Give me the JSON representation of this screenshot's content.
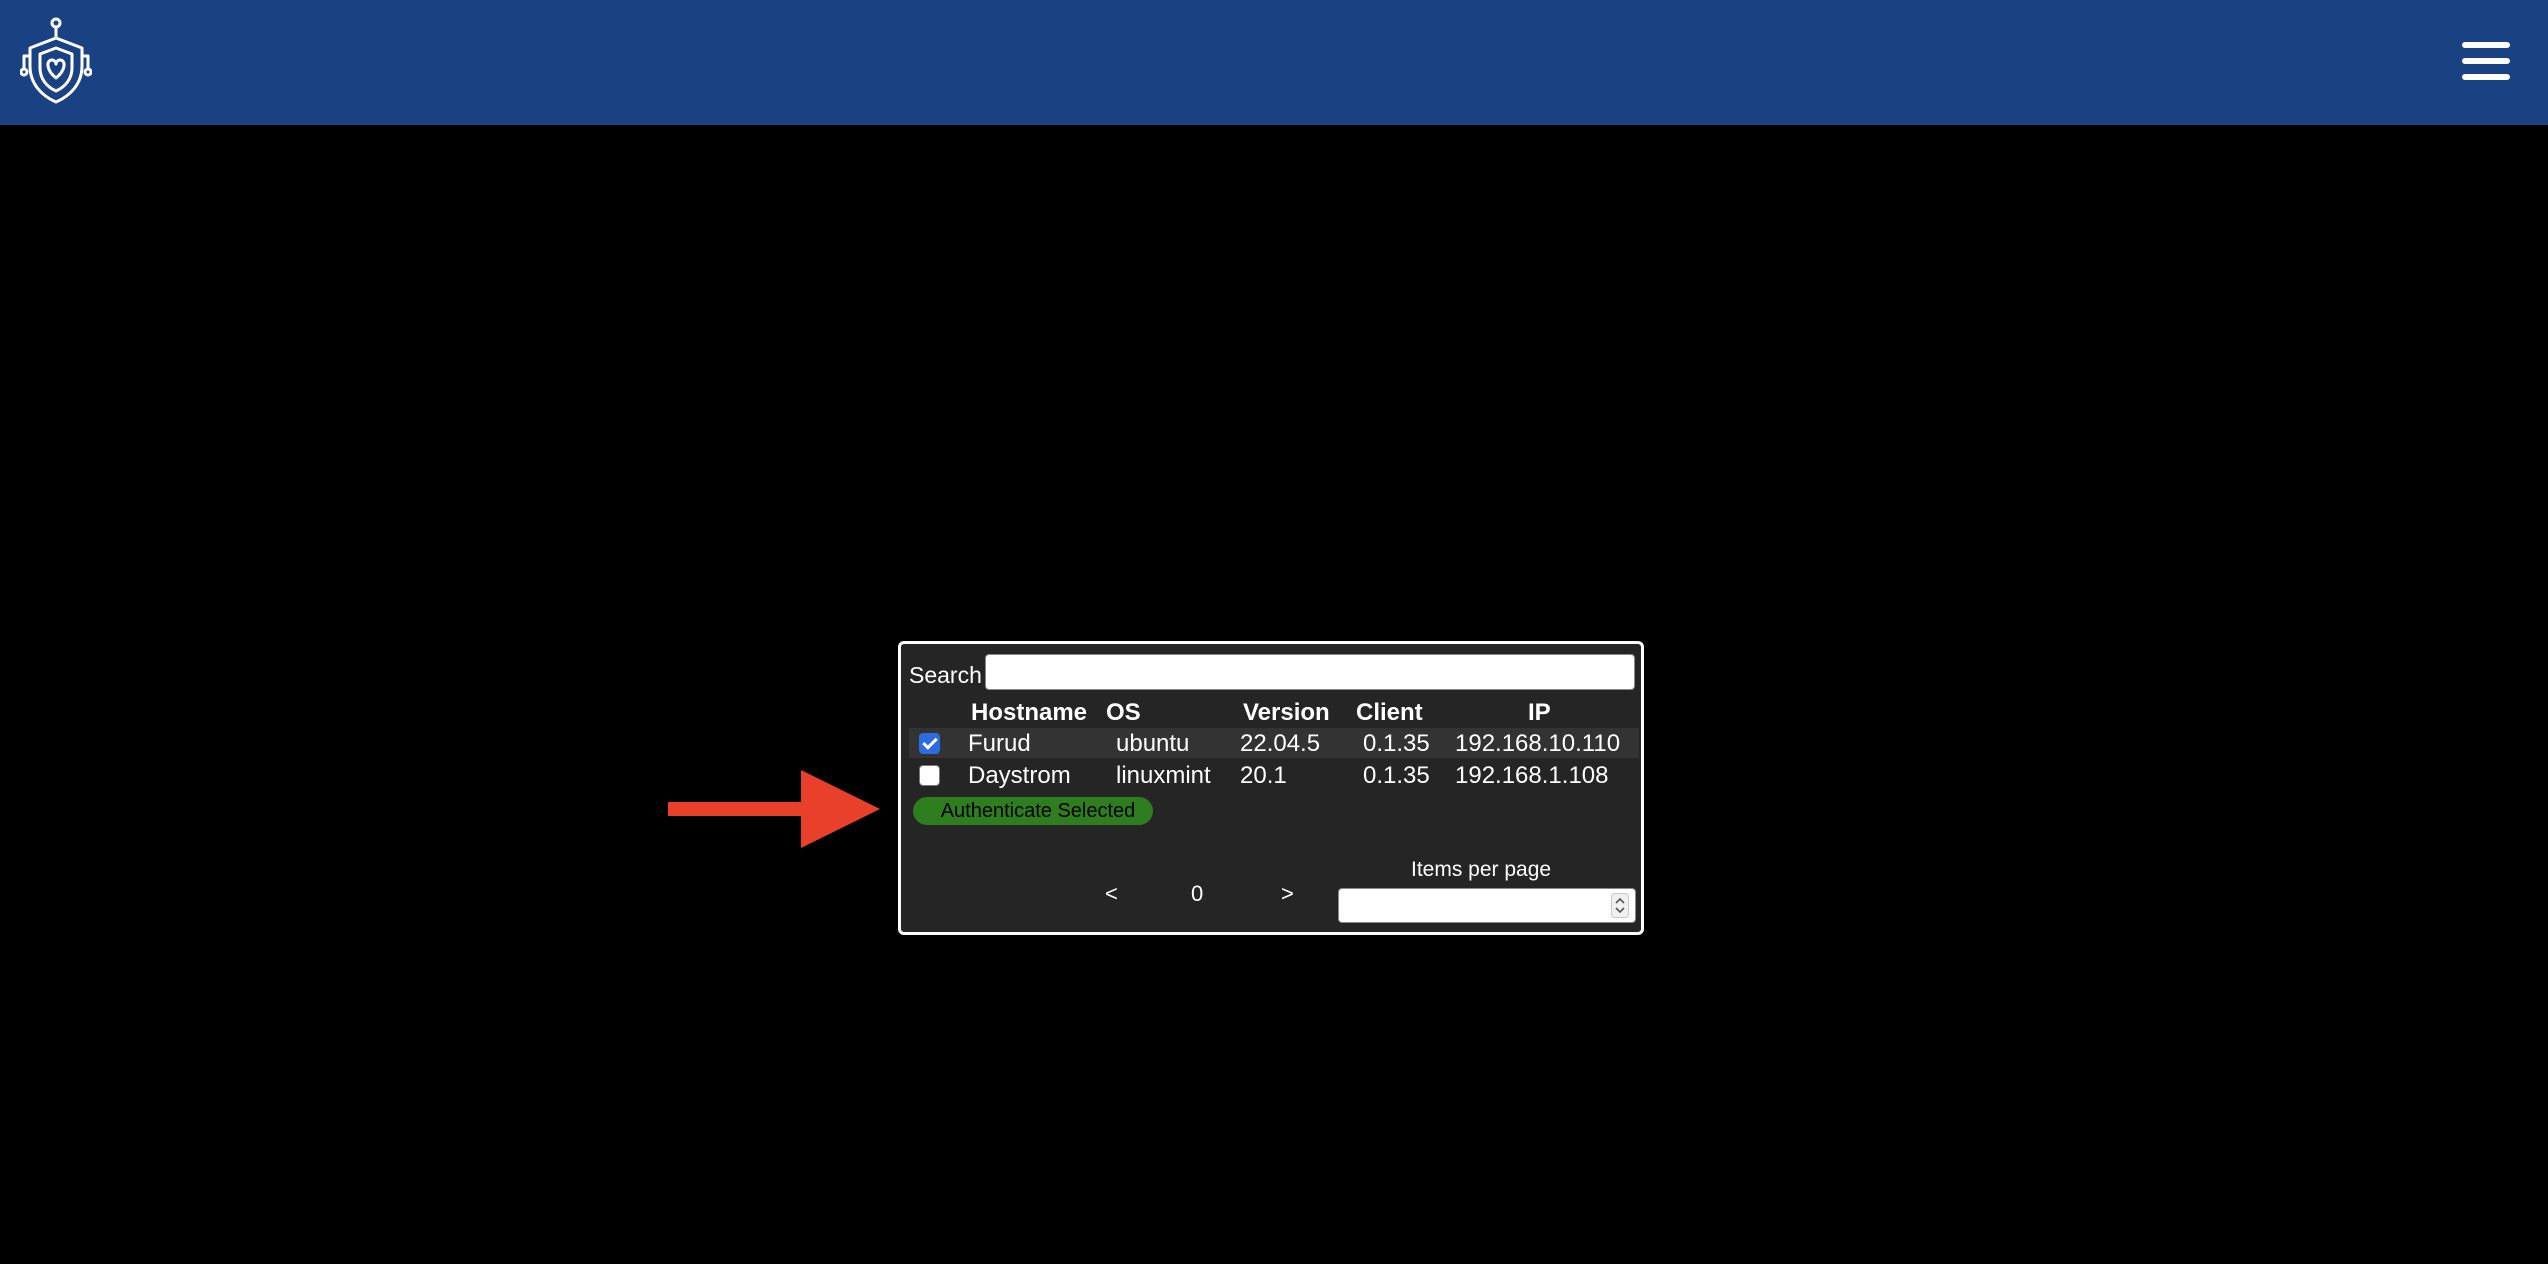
{
  "header": {
    "logo_icon": "shield-heart-circuit-icon",
    "menu_icon": "hamburger-menu-icon",
    "background_color": "#1a4282"
  },
  "panel": {
    "search": {
      "label": "Search",
      "value": "",
      "placeholder": ""
    },
    "columns": [
      "Hostname",
      "OS",
      "Version",
      "Client",
      "IP"
    ],
    "rows": [
      {
        "selected": true,
        "hostname": "Furud",
        "os": "ubuntu",
        "version": "22.04.5",
        "client": "0.1.35",
        "ip": "192.168.10.110"
      },
      {
        "selected": false,
        "hostname": "Daystrom",
        "os": "linuxmint",
        "version": "20.1",
        "client": "0.1.35",
        "ip": "192.168.1.108"
      }
    ],
    "authenticate_label": "Authenticate Selected",
    "authenticate_color": "#2e7d1e",
    "pagination": {
      "prev": "<",
      "page": "0",
      "next": ">",
      "items_per_page_label": "Items per page",
      "items_per_page_value": ""
    }
  },
  "annotation": {
    "arrow_icon": "red-arrow-right-icon",
    "color": "#e8402a"
  }
}
